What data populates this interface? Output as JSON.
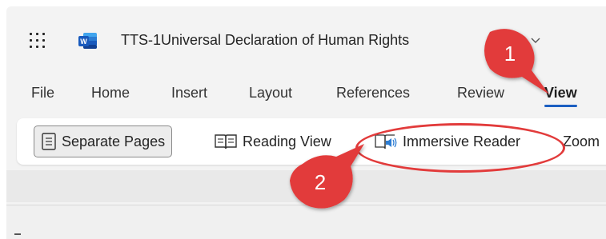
{
  "titlebar": {
    "app_launcher_icon": "waffle-grid-icon",
    "app_icon": "word-logo-icon",
    "document_title": "TTS-1Universal Declaration of Human Rights",
    "chevron_icon": "chevron-down-icon"
  },
  "tabs": [
    {
      "label": "File"
    },
    {
      "label": "Home"
    },
    {
      "label": "Insert"
    },
    {
      "label": "Layout"
    },
    {
      "label": "References"
    },
    {
      "label": "Review"
    },
    {
      "label": "View",
      "active": true
    }
  ],
  "ribbon": {
    "separate_pages": {
      "label": "Separate Pages",
      "icon": "page-icon",
      "selected": true
    },
    "reading_view": {
      "label": "Reading View",
      "icon": "open-book-icon"
    },
    "immersive_reader": {
      "label": "Immersive Reader",
      "icon": "immersive-reader-icon"
    },
    "zoom": {
      "label": "Zoom"
    }
  },
  "annotations": {
    "callout_1": "1",
    "callout_2": "2",
    "color": "#e23b3b"
  },
  "colors": {
    "accent": "#1b5fc1",
    "word_blue": "#185abd",
    "annotation_red": "#e23b3b"
  }
}
